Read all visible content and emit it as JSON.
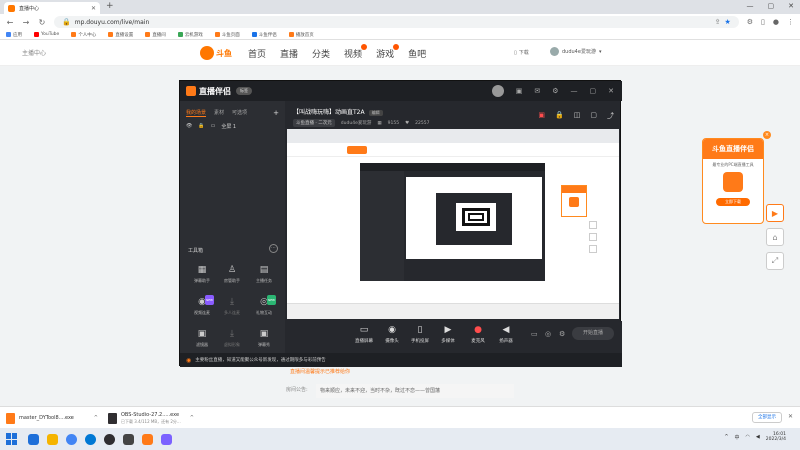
{
  "browser": {
    "tab_title": "直播中心",
    "url": "mp.douyu.com/live/main",
    "bookmarks": [
      "应用",
      "YouTube",
      "个人中心",
      "直播设置",
      "直播间",
      "云机游戏",
      "斗鱼页面",
      "斗鱼伴侣",
      "播放首页"
    ]
  },
  "site": {
    "left_text": "主播中心",
    "logo_text": "斗鱼",
    "nav": [
      "首页",
      "直播",
      "分类",
      "视频",
      "游戏",
      "鱼吧"
    ],
    "download": "下载",
    "username": "dudu4e爱玩游"
  },
  "app": {
    "brand": "直播伴侣",
    "version_tag": "标签",
    "left_tabs": [
      "我的场景",
      "素材",
      "可选项"
    ],
    "scene_name": "全屏 1",
    "tools_title": "工具箱",
    "tools": [
      {
        "label": "弹幕助手",
        "icon": "▦"
      },
      {
        "label": "房管助手",
        "icon": "♙"
      },
      {
        "label": "主播任务",
        "icon": "▤"
      },
      {
        "label": "视频连麦",
        "icon": "◉",
        "tag": "NEW"
      },
      {
        "label": "多人连麦",
        "icon": "⤓"
      },
      {
        "label": "礼物互动",
        "icon": "◎",
        "tag": "NEW"
      },
      {
        "label": "滤镜器",
        "icon": "▣"
      },
      {
        "label": "虚拟形象",
        "icon": "⤓"
      },
      {
        "label": "弹幕秀",
        "icon": "▣"
      },
      {
        "label": "更多工具",
        "icon": "▥"
      },
      {
        "label": "直播推荐",
        "icon": "◈",
        "tag": "HOT"
      },
      {
        "label": "下载",
        "icon": "⤓"
      }
    ],
    "stream_title": "【叫战嗨玩嗨】动画直T2A",
    "edit_label": "编辑",
    "category": "斗鱼直播 · 二次元",
    "streamer": "dudu4e爱玩游",
    "room_id": "9155",
    "followers": "22557",
    "controls": [
      {
        "label": "直播屏幕",
        "icon": "▭"
      },
      {
        "label": "摄像头",
        "icon": "◉"
      },
      {
        "label": "手机投屏",
        "icon": "▯"
      },
      {
        "label": "多媒体",
        "icon": "▶"
      },
      {
        "label": "麦克风",
        "icon": "●",
        "red": true
      },
      {
        "label": "扬声器",
        "icon": "◀"
      }
    ],
    "go_live": "开始直播",
    "status_text": "主要粉丝直播，知道又能聚公众号新发现，通过期限多与彩前预告"
  },
  "page": {
    "notice_label": "房间公告:",
    "notice_text": "物来顺应，未来不迎，当时不杂，既过不恋——曾国藩",
    "above_notice": "直播间温馨提示已推荐给你"
  },
  "promo": {
    "title": "斗鱼直播伴侣",
    "subtitle": "最专业的PC端直播工具",
    "button": "立即下载",
    "close": "×"
  },
  "downloads": [
    {
      "name": "master_DYTool8....exe",
      "sub": ""
    },
    {
      "name": "OBS-Studio-27.2.....exe",
      "sub": "已下载 3.4/112 MB，还有 2分..."
    }
  ],
  "download_show_all": "全部显示",
  "taskbar": {
    "time": "16:01",
    "date": "2022/3/4",
    "lang": "中"
  },
  "colors": {
    "brand_orange": "#ff7a18",
    "app_dark": "#26282d"
  }
}
